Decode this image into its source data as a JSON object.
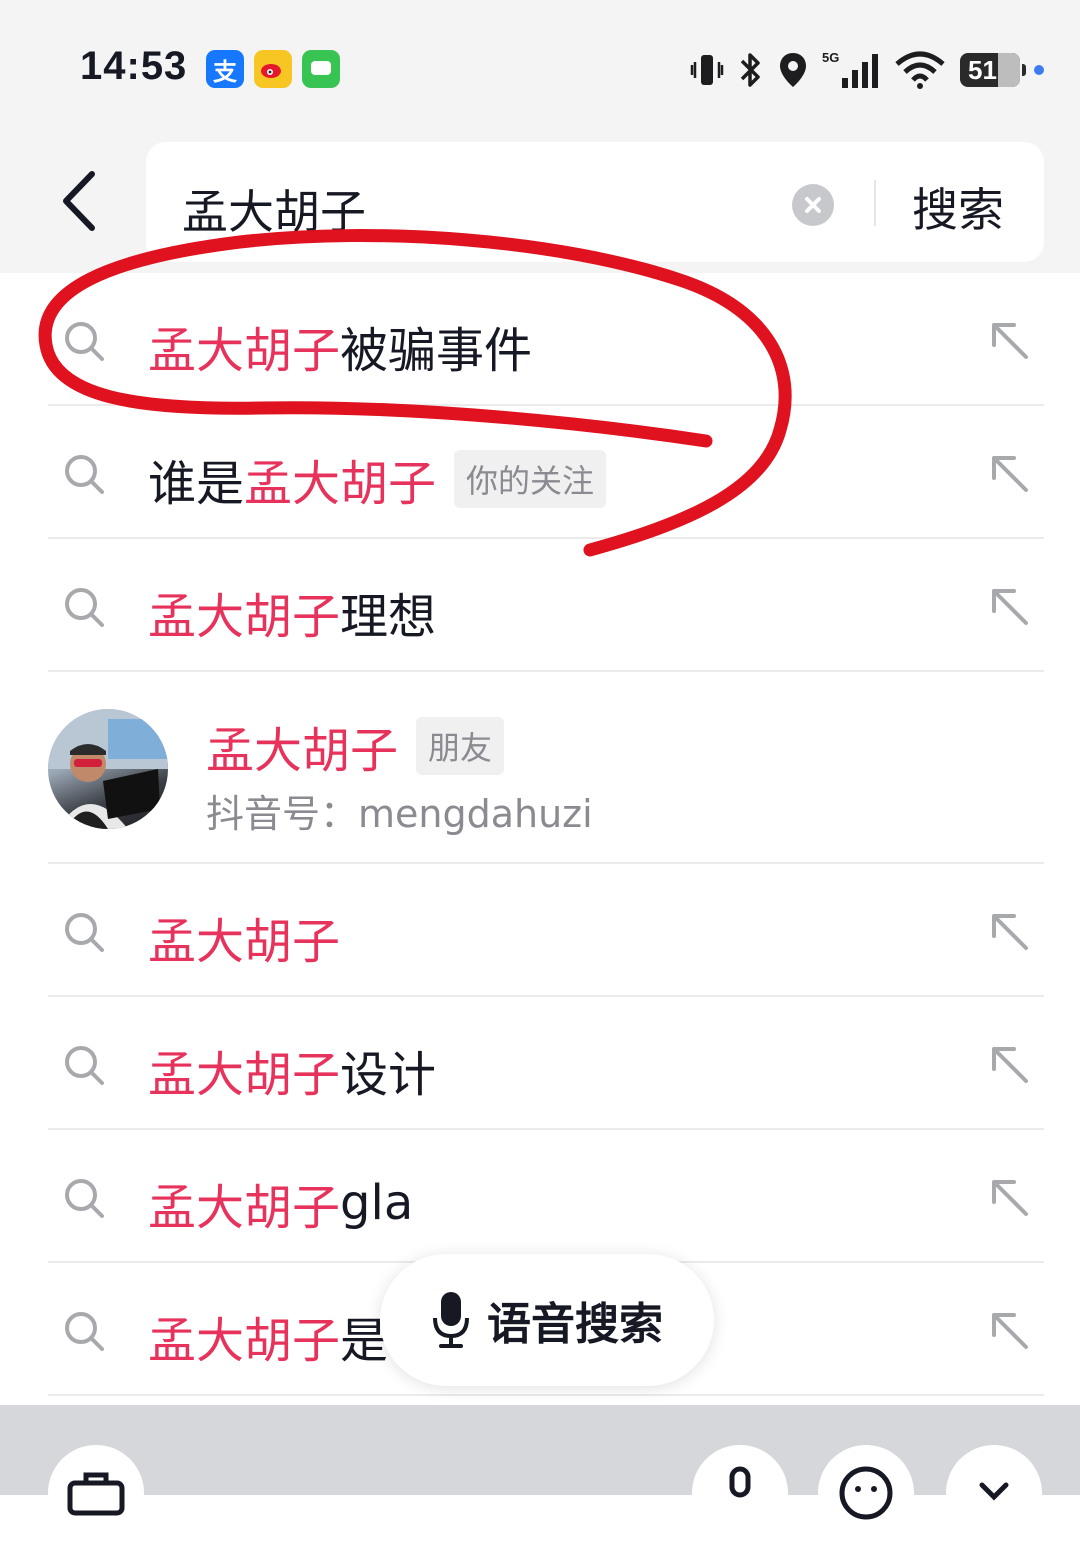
{
  "status_bar": {
    "time": "14:53",
    "app_icons": [
      "alipay-icon",
      "weibo-icon",
      "messages-icon"
    ],
    "network": "5G",
    "battery": "51"
  },
  "search": {
    "query": "孟大胡子",
    "submit_label": "搜索"
  },
  "suggestions": [
    {
      "prefix": "",
      "highlight": "孟大胡子",
      "suffix": "被骗事件",
      "tag": ""
    },
    {
      "prefix": "谁是",
      "highlight": "孟大胡子",
      "suffix": "",
      "tag": "你的关注"
    },
    {
      "prefix": "",
      "highlight": "孟大胡子",
      "suffix": "理想",
      "tag": ""
    }
  ],
  "user_result": {
    "name": "孟大胡子",
    "badge": "朋友",
    "douyin_id": "抖音号：mengdahuzi"
  },
  "more_suggestions": [
    {
      "prefix": "",
      "highlight": "孟大胡子",
      "suffix": ""
    },
    {
      "prefix": "",
      "highlight": "孟大胡子",
      "suffix": "设计"
    },
    {
      "prefix": "",
      "highlight": "孟大胡子",
      "suffix": "gla"
    },
    {
      "prefix": "",
      "highlight": "孟大胡子",
      "suffix": "是"
    }
  ],
  "voice_search": {
    "label": "语音搜索"
  },
  "colors": {
    "highlight": "#e7335b",
    "annotation": "#e0121f"
  }
}
